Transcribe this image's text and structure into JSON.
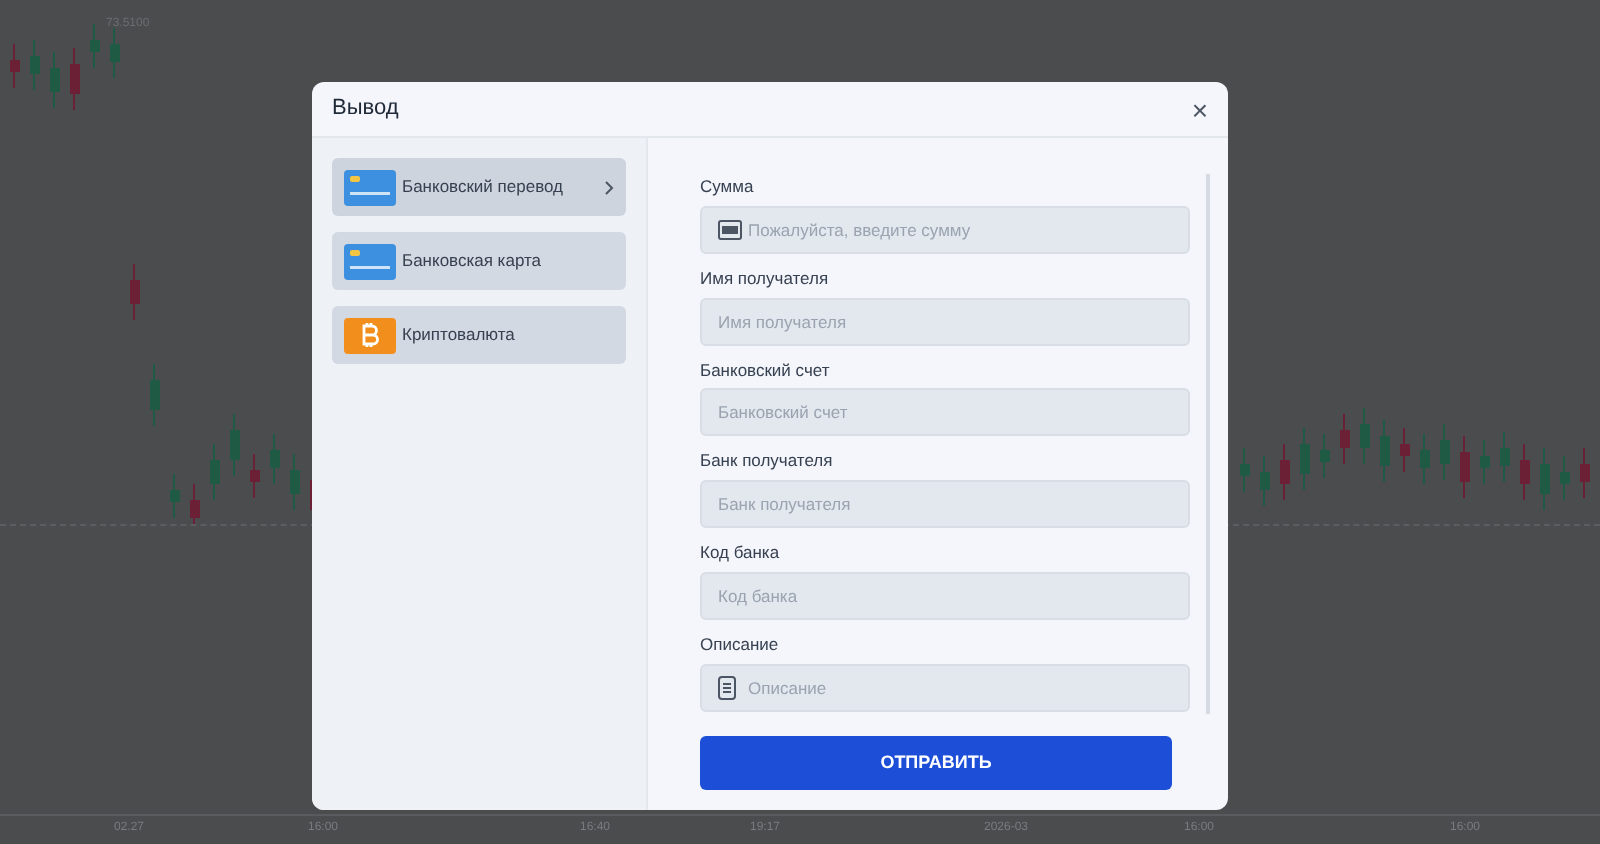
{
  "chart": {
    "price_label": "73.5100",
    "time_axis": [
      "02.27",
      "16:00",
      "16:40",
      "19:17",
      "2026-03",
      "16:00",
      "16:00"
    ]
  },
  "dialog": {
    "title": "Вывод",
    "close": "×",
    "methods": [
      {
        "label": "Банковский перевод",
        "kind": "card",
        "selected": true
      },
      {
        "label": "Банковская карта",
        "kind": "card",
        "selected": false
      },
      {
        "label": "Криптовалюта",
        "kind": "crypto",
        "selected": false
      }
    ],
    "fields": [
      {
        "label": "Сумма",
        "placeholder": "Пожалуйста, введите сумму",
        "kind": "money"
      },
      {
        "label": "Имя получателя",
        "placeholder": "Имя получателя",
        "kind": "plain"
      },
      {
        "label": "Банковский счет",
        "placeholder": "Банковский счет",
        "kind": "plain"
      },
      {
        "label": "Банк получателя",
        "placeholder": "Банк получателя",
        "kind": "plain"
      },
      {
        "label": "Код банка",
        "placeholder": "Код банка",
        "kind": "plain"
      },
      {
        "label": "Описание",
        "placeholder": "Описание",
        "kind": "note"
      }
    ],
    "submit": "ОТПРАВИТЬ"
  }
}
